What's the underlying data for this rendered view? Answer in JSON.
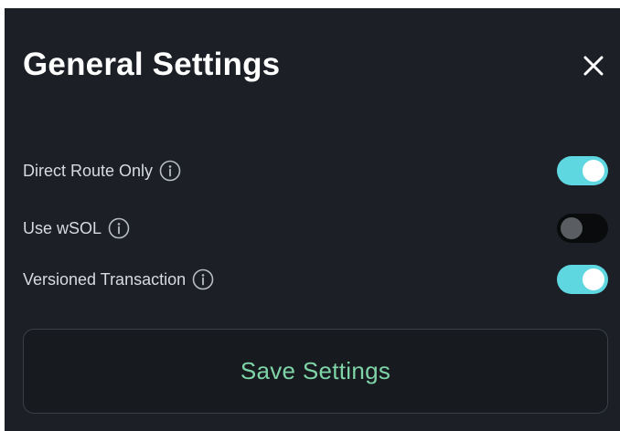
{
  "dialog": {
    "title": "General Settings",
    "close_icon": "close-icon"
  },
  "settings": [
    {
      "label": "Direct Route Only",
      "enabled": true,
      "icon": "info-icon"
    },
    {
      "label": "Use wSOL",
      "enabled": false,
      "icon": "info-icon"
    },
    {
      "label": "Versioned Transaction",
      "enabled": true,
      "icon": "info-icon"
    }
  ],
  "save_button": {
    "label": "Save Settings"
  },
  "colors": {
    "panel_bg": "#1c2026",
    "toggle_on": "#5fd7e1",
    "toggle_off": "#0a0b0d",
    "save_text": "#7fd4a7"
  }
}
